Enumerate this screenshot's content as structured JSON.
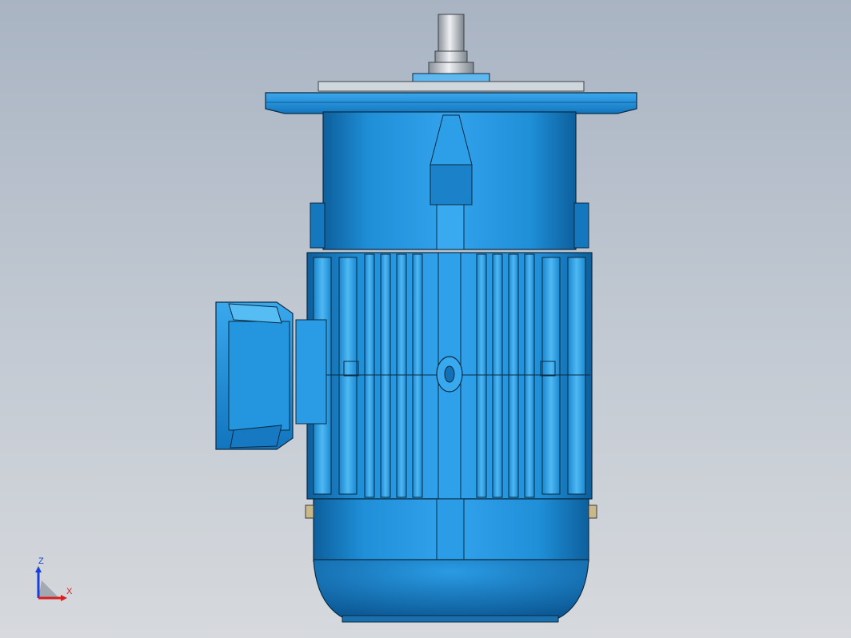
{
  "viewport": {
    "model": "vertical-flange-motor",
    "background": {
      "top": "#a9b4c3",
      "bottom": "#d6d9dd"
    },
    "colors": {
      "body_main": "#1e8ed6",
      "body_light": "#4db4f0",
      "body_dark": "#0c5d9a",
      "edge": "#0a2a40",
      "shaft": "#c8ccd0"
    }
  },
  "triad": {
    "z_label": "Z",
    "x_label": "X",
    "z_color": "#1a3fd6",
    "x_color": "#d62020"
  }
}
